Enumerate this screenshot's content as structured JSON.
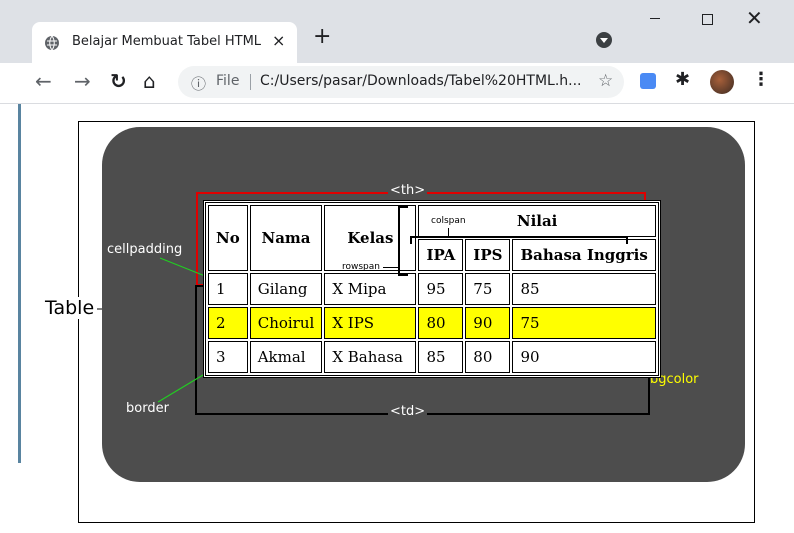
{
  "browser": {
    "tab_title": "Belajar Membuat Tabel HTML",
    "tab_close": "×",
    "new_tab": "+",
    "url_prefix": "File",
    "url": "C:/Users/pasar/Downloads/Tabel%20HTML.h...",
    "win_close": "✕"
  },
  "diagram": {
    "table_label": "Table",
    "th_label": "<th>",
    "td_label": "<td>",
    "cellpadding_label": "cellpadding",
    "border_label": "border",
    "bgcolor_label": "bgcolor",
    "colspan_label": "colspan",
    "rowspan_label": "rowspan",
    "bgcolor_color": "#ffff00",
    "th_box_color": "#e00000",
    "line_color": "#22cc22"
  },
  "table": {
    "headers": {
      "no": "No",
      "nama": "Nama",
      "kelas": "Kelas",
      "nilai": "Nilai",
      "ipa": "IPA",
      "ips": "IPS",
      "bahasa": "Bahasa Inggris"
    },
    "rows": [
      [
        "1",
        "Gilang",
        "X Mipa",
        "95",
        "75",
        "85"
      ],
      [
        "2",
        "Choirul",
        "X IPS",
        "80",
        "90",
        "75"
      ],
      [
        "3",
        "Akmal",
        "X Bahasa",
        "85",
        "80",
        "90"
      ]
    ]
  }
}
